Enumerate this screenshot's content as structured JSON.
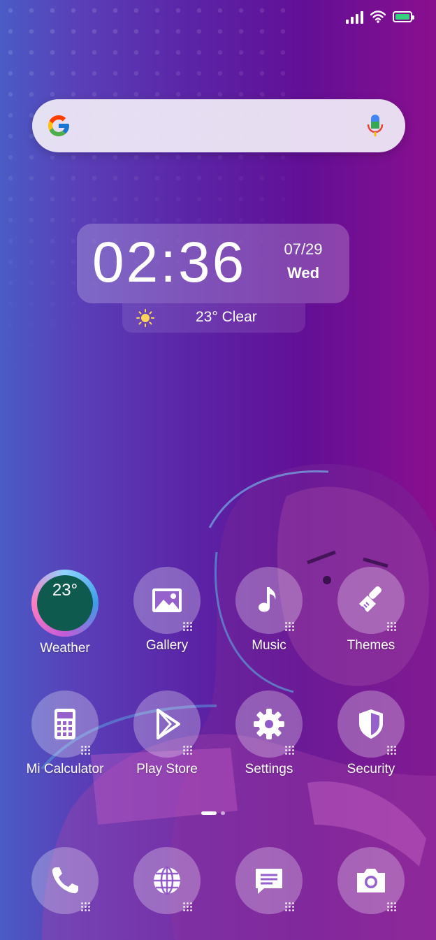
{
  "status_bar": {
    "battery_color": "#35d07f"
  },
  "search": {
    "google_icon": "google-g-icon",
    "mic_icon": "mic-icon"
  },
  "clock": {
    "time": "02:36",
    "date": "07/29",
    "day": "Wed"
  },
  "weather_widget": {
    "icon": "sun-icon",
    "text": "23° Clear"
  },
  "apps_row1": [
    {
      "label": "Weather",
      "icon": "weather-icon",
      "temp": "23°"
    },
    {
      "label": "Gallery",
      "icon": "gallery-icon"
    },
    {
      "label": "Music",
      "icon": "music-note-icon"
    },
    {
      "label": "Themes",
      "icon": "paintbrush-icon"
    }
  ],
  "apps_row2": [
    {
      "label": "Mi Calculator",
      "icon": "calculator-icon"
    },
    {
      "label": "Play Store",
      "icon": "play-store-icon"
    },
    {
      "label": "Settings",
      "icon": "gear-icon"
    },
    {
      "label": "Security",
      "icon": "shield-icon"
    }
  ],
  "dock": [
    {
      "name": "Phone",
      "icon": "phone-icon"
    },
    {
      "name": "Browser",
      "icon": "globe-icon"
    },
    {
      "name": "Messages",
      "icon": "message-icon"
    },
    {
      "name": "Camera",
      "icon": "camera-icon"
    }
  ],
  "page_indicator": {
    "pages": 2,
    "current": 1
  }
}
